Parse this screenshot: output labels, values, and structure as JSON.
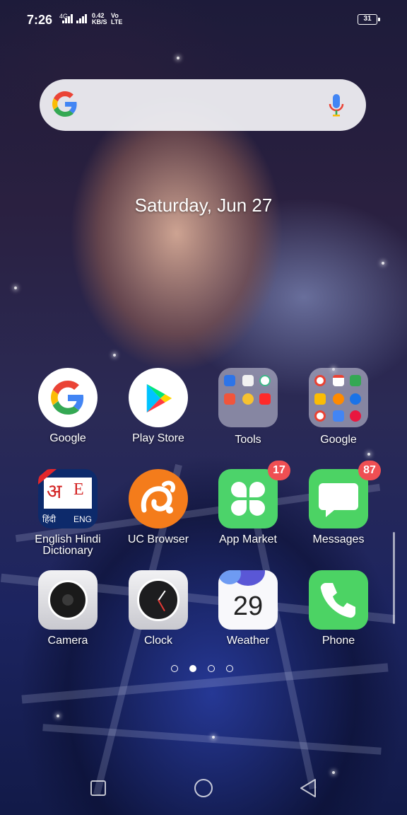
{
  "status_bar": {
    "time": "7:26",
    "network_type": "4G",
    "speed_value": "0.42",
    "speed_unit": "KB/S",
    "volte": "Vo",
    "lte": "LTE",
    "battery": "31"
  },
  "search": {
    "logo_icon": "google-g-icon",
    "mic_icon": "mic-icon"
  },
  "date": "Saturday, Jun 27",
  "apps": [
    {
      "label": "Google",
      "icon": "google-icon"
    },
    {
      "label": "Play Store",
      "icon": "play-store-icon"
    },
    {
      "label": "Tools",
      "icon": "folder-icon"
    },
    {
      "label": "Google",
      "icon": "folder-icon"
    },
    {
      "label": "English Hindi Dictionary",
      "icon": "dictionary-icon",
      "icon_text_a": "अ",
      "icon_text_e": "E",
      "icon_text_hindi": "हिंदी",
      "icon_text_eng": "ENG"
    },
    {
      "label": "UC Browser",
      "icon": "uc-browser-icon"
    },
    {
      "label": "App Market",
      "icon": "app-market-icon",
      "badge": "17"
    },
    {
      "label": "Messages",
      "icon": "messages-icon",
      "badge": "87"
    },
    {
      "label": "Camera",
      "icon": "camera-icon"
    },
    {
      "label": "Clock",
      "icon": "clock-icon"
    },
    {
      "label": "Weather",
      "icon": "weather-icon",
      "icon_text": "29"
    },
    {
      "label": "Phone",
      "icon": "phone-icon"
    }
  ],
  "page_indicator": {
    "count": 4,
    "active_index": 1
  },
  "nav_bar": {
    "recents": "recents-icon",
    "home": "home-icon",
    "back": "back-icon"
  },
  "colors": {
    "badge": "#ef4f53",
    "app_market": "#4cd36a",
    "messages": "#4cd364",
    "phone": "#4cd364",
    "uc_browser": "#f47c1b"
  }
}
